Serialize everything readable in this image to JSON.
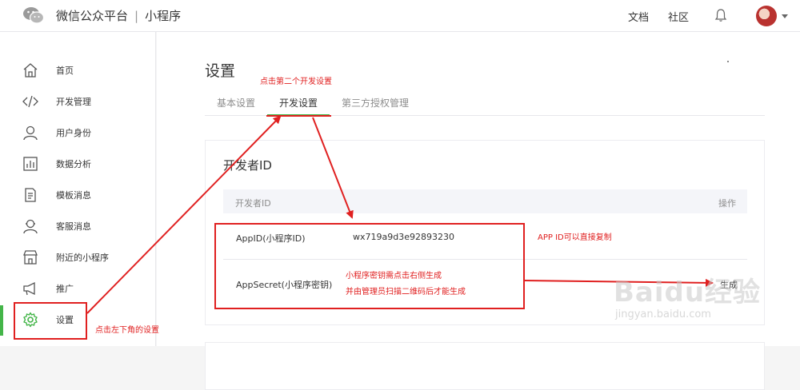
{
  "header": {
    "brand": "微信公众平台",
    "separator": "|",
    "product": "小程序",
    "nav": [
      "文档",
      "社区"
    ]
  },
  "sidebar": {
    "items": [
      {
        "label": "首页",
        "icon": "home-icon"
      },
      {
        "label": "开发管理",
        "icon": "code-icon"
      },
      {
        "label": "用户身份",
        "icon": "user-icon"
      },
      {
        "label": "数据分析",
        "icon": "chart-icon"
      },
      {
        "label": "模板消息",
        "icon": "document-icon"
      },
      {
        "label": "客服消息",
        "icon": "headset-user-icon"
      },
      {
        "label": "附近的小程序",
        "icon": "store-icon"
      },
      {
        "label": "推广",
        "icon": "megaphone-icon"
      },
      {
        "label": "设置",
        "icon": "gear-icon"
      }
    ],
    "active_index": 8
  },
  "main": {
    "title": "设置",
    "tabs": [
      {
        "label": "基本设置"
      },
      {
        "label": "开发设置"
      },
      {
        "label": "第三方授权管理"
      }
    ],
    "selected_tab": 1,
    "card": {
      "title": "开发者ID",
      "columns": [
        "开发者ID",
        "操作"
      ],
      "rows": [
        {
          "key": "AppID(小程序ID)",
          "value": "wx719a9d3e92893230",
          "op": ""
        },
        {
          "key": "AppSecret(小程序密钥)",
          "value": "",
          "op": "生成"
        }
      ]
    }
  },
  "annotations": {
    "second_tab": "点击第二个开发设置",
    "bottom_left": "点击左下角的设置",
    "appid_note": "APP ID可以直接复制",
    "secret_line1": "小程序密钥需点击右侧生成",
    "secret_line2": "并由管理员扫描二维码后才能生成"
  },
  "watermark": {
    "big": "Baidu经验",
    "small": "jingyan.baidu.com"
  },
  "colors": {
    "accent": "#44b549",
    "annotation": "#e02020"
  }
}
